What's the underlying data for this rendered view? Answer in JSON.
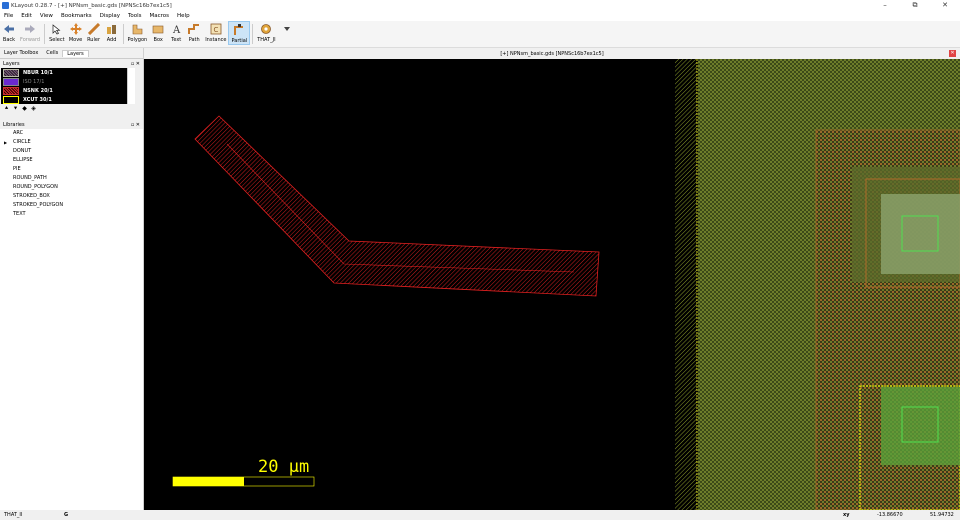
{
  "window": {
    "title": "KLayout 0.28.7 - [+] NPNsm_basic.gds [NPNSc16b7ex1c5]",
    "controls": [
      "–",
      "⧉",
      "✕"
    ]
  },
  "menu": [
    "File",
    "Edit",
    "View",
    "Bookmarks",
    "Display",
    "Tools",
    "Macros",
    "Help"
  ],
  "toolbar": {
    "items": [
      {
        "label": "Back",
        "icon": "back-arrow-icon"
      },
      {
        "label": "Forward",
        "icon": "forward-arrow-icon",
        "disabled": true
      },
      {
        "label": "Select",
        "icon": "select-pointer-icon"
      },
      {
        "label": "Move",
        "icon": "move-cross-icon"
      },
      {
        "label": "Ruler",
        "icon": "ruler-icon"
      },
      {
        "label": "Add",
        "icon": "add-icon"
      },
      {
        "label": "Polygon",
        "icon": "polygon-icon"
      },
      {
        "label": "Box",
        "icon": "box-icon"
      },
      {
        "label": "Text",
        "icon": "text-icon"
      },
      {
        "label": "Path",
        "icon": "path-icon"
      },
      {
        "label": "Instance",
        "icon": "instance-icon"
      },
      {
        "label": "Partial",
        "icon": "partial-icon",
        "active": true
      },
      {
        "label": "THAT_JI",
        "icon": "gear-icon"
      }
    ]
  },
  "left_tabs": [
    "Layer Toolbox",
    "Cells",
    "Layers"
  ],
  "layers_panel": {
    "title": "Layers",
    "layers": [
      {
        "name": "NBUR 10/1",
        "color": "#7a5c7a"
      },
      {
        "name": "ISO 17/1",
        "color": "#6a2ad0",
        "dim": true
      },
      {
        "name": "NSNK 20/1",
        "color": "#d03030"
      },
      {
        "name": "XCUT 30/1",
        "color": "#ffff00"
      }
    ]
  },
  "libraries_panel": {
    "title": "Libraries",
    "items": [
      "ARC",
      "CIRCLE",
      "DONUT",
      "ELLIPSE",
      "PIE",
      "ROUND_PATH",
      "ROUND_POLYGON",
      "STROKED_BOX",
      "STROKED_POLYGON",
      "TEXT"
    ],
    "expanded_marker_index": 1
  },
  "view": {
    "tab_title": "[+] NPNsm_basic.gds [NPNSc16b7ex1c5]",
    "scale_label": "20 µm"
  },
  "status": {
    "mode": "THAT_II",
    "key": "G",
    "coord_label": "xy",
    "x": "-13.86670",
    "y": "51.94732"
  }
}
